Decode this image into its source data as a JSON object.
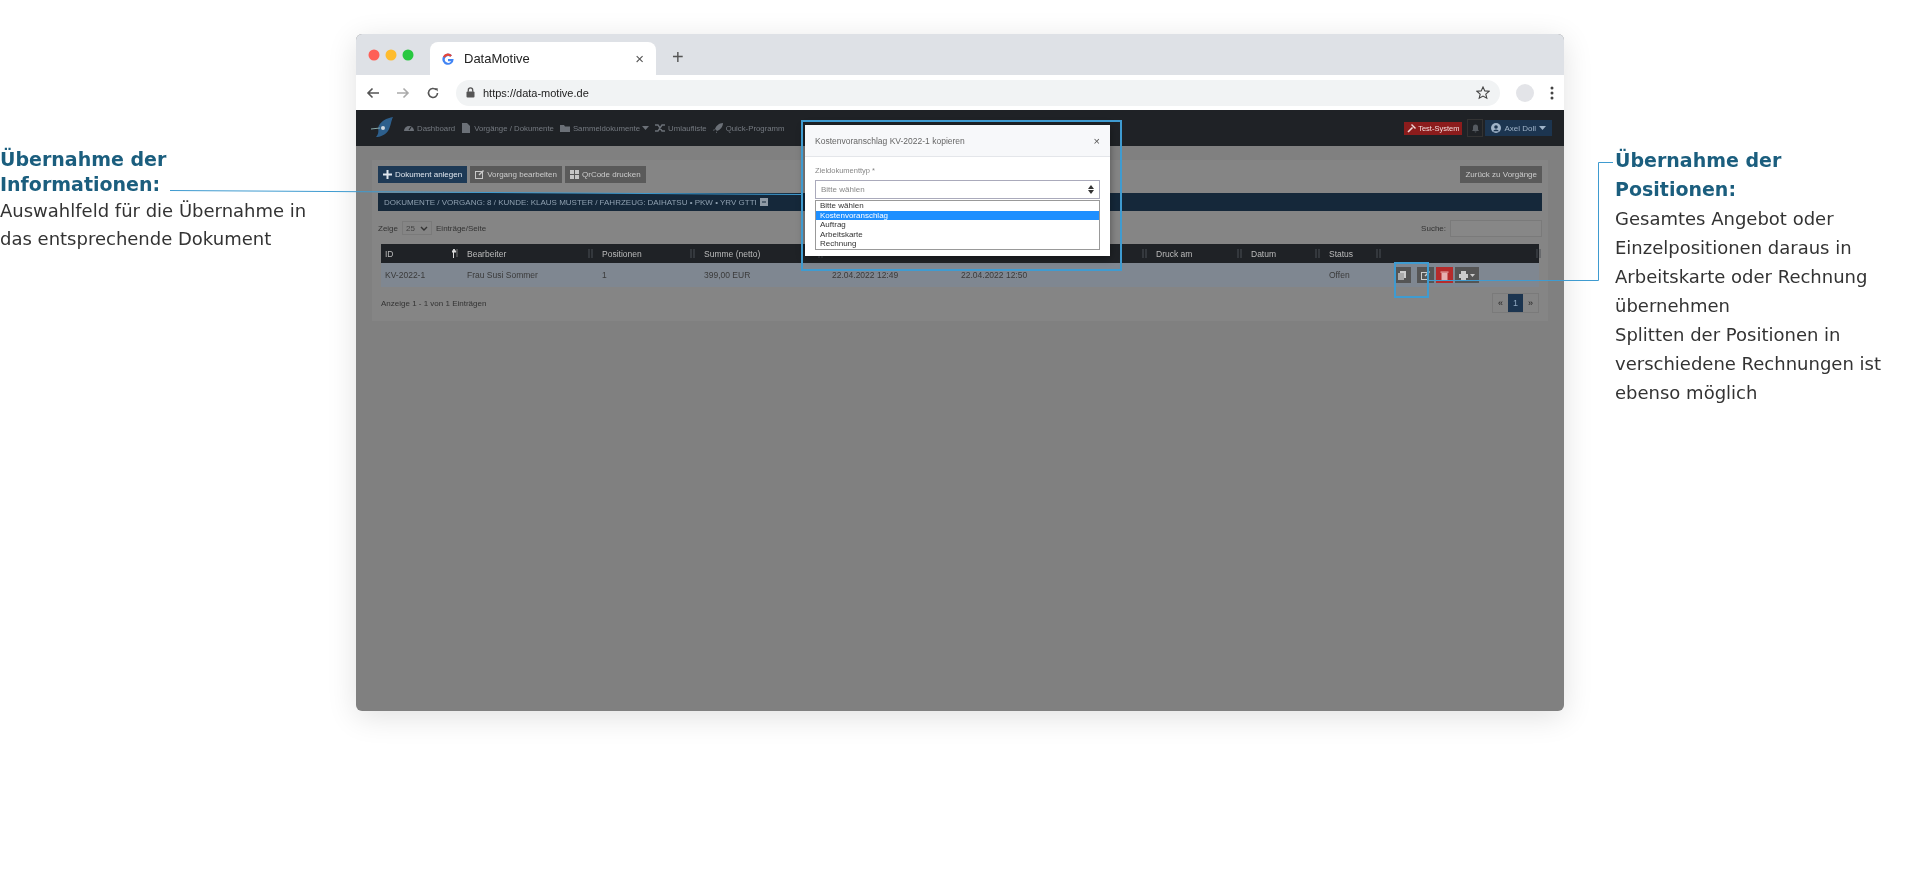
{
  "annotations": [
    {
      "title": "Übernahme der Informationen:",
      "lines": [
        "Auswahlfeld für die Übernahme in das entsprechende Dokument"
      ]
    },
    {
      "title": "Übernahme der Positionen:",
      "lines": [
        "Gesamtes Angebot oder Einzelpositionen daraus in Arbeitskarte oder Rechnung übernehmen",
        "Splitten der Positionen in verschiedene Rechnungen ist ebenso möglich"
      ]
    }
  ],
  "browser": {
    "tab_title": "DataMotive",
    "tab_close": "×",
    "new_tab": "+",
    "url": "https://data-motive.de"
  },
  "navbar": {
    "items": [
      {
        "label": "Dashboard",
        "dropdown": false
      },
      {
        "label": "Vorgänge / Dokumente",
        "dropdown": false
      },
      {
        "label": "Sammeldokumente",
        "dropdown": true
      },
      {
        "label": "Umlaufliste",
        "dropdown": false
      },
      {
        "label": "Quick-Programm",
        "dropdown": false
      }
    ],
    "badge": "Test-System",
    "user": "Axel Doll"
  },
  "toolbar": {
    "buttons": [
      {
        "label": "Dokument anlegen",
        "kind": "primary"
      },
      {
        "label": "Vorgang bearbeiten",
        "kind": "default"
      },
      {
        "label": "QrCode drucken",
        "kind": "default"
      }
    ],
    "back_button": "Zurück zu Vorgänge"
  },
  "panel_title": "DOKUMENTE / VORGANG: 8 / KUNDE: KLAUS MUSTER / FAHRZEUG: DAIHATSU • PKW • YRV GTTI",
  "length": {
    "before": "Zeige",
    "value": "25",
    "after": "Einträge/Seite"
  },
  "search": {
    "label": "Suche:"
  },
  "table": {
    "columns": [
      {
        "label": "ID",
        "sorted": true
      },
      {
        "label": "Bearbeiter",
        "sorted": false
      },
      {
        "label": "Positionen",
        "sorted": false
      },
      {
        "label": "Summe (netto)",
        "sorted": false
      },
      {},
      {},
      {
        "sorted": false
      },
      {
        "label": "Druck am",
        "sorted": false
      },
      {
        "label": "Datum",
        "sorted": false
      },
      {
        "label": "Status",
        "sorted": false
      },
      {
        "sorted": false
      }
    ],
    "rows": [
      {
        "cells": [
          {
            "text": "KV-2022-1"
          },
          {
            "text": "Frau Susi Sommer"
          },
          {
            "text": "1"
          },
          {
            "text": "399,00 EUR"
          },
          {
            "text": "22.04.2022 12:49"
          },
          {
            "text": "22.04.2022 12:50"
          },
          {},
          {},
          {},
          {
            "text": "Offen"
          }
        ],
        "actions": [
          {
            "kind": "copy"
          },
          {
            "kind": "edit"
          },
          {
            "kind": "delete"
          },
          {
            "kind": "print"
          }
        ]
      }
    ]
  },
  "info": "Anzeige 1 - 1 von 1 Einträgen",
  "pagination": [
    {
      "label": "«",
      "selected": false
    },
    {
      "label": "1",
      "selected": true
    },
    {
      "label": "»",
      "selected": false
    }
  ],
  "modal": {
    "title": "Kostenvoranschlag KV-2022-1 kopieren",
    "close": "×",
    "field_label": "Zieldokumenttyp *",
    "value": "Bitte wählen",
    "options": [
      {
        "label": "Bitte wählen",
        "highlighted": false
      },
      {
        "label": "Kostenvoranschlag",
        "highlighted": true
      },
      {
        "label": "Auftrag",
        "highlighted": false
      },
      {
        "label": "Arbeitskarte",
        "highlighted": false
      },
      {
        "label": "Rechnung",
        "highlighted": false
      }
    ]
  }
}
